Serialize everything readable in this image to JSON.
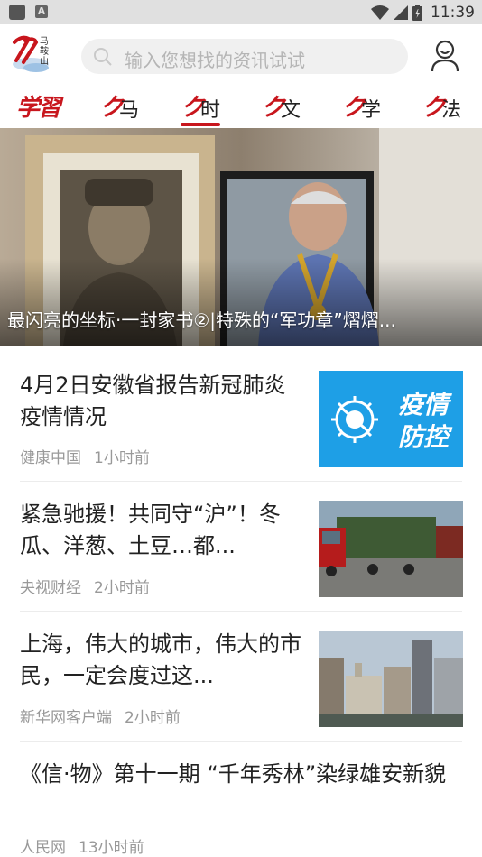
{
  "status_bar": {
    "time": "11:39"
  },
  "header": {
    "logo_text": "马鞍山",
    "search_placeholder": "输入您想找的资讯试试"
  },
  "tabs": {
    "study": "学習",
    "items": [
      {
        "mark": "ク",
        "label": "马"
      },
      {
        "mark": "ク",
        "label": "时"
      },
      {
        "mark": "ク",
        "label": "文"
      },
      {
        "mark": "ク",
        "label": "学"
      },
      {
        "mark": "ク",
        "label": "法"
      }
    ],
    "active_index": 1,
    "accent": "#c8161d"
  },
  "hero": {
    "caption": "最闪亮的坐标·一封家书②|特殊的“军功章”熠熠..."
  },
  "news": [
    {
      "title": "4月2日安徽省报告新冠肺炎疫情情况",
      "source": "健康中国",
      "time": "1小时前",
      "thumb_text_line1": "疫情",
      "thumb_text_line2": "防控"
    },
    {
      "title": "紧急驰援！共同守“沪”！冬瓜、洋葱、土豆…都...",
      "source": "央视财经",
      "time": "2小时前"
    },
    {
      "title": "上海，伟大的城市，伟大的市民，一定会度过这...",
      "source": "新华网客户端",
      "time": "2小时前"
    },
    {
      "title": "《信·物》第十一期 “千年秀林”染绿雄安新貌",
      "source": "人民网",
      "time": "13小时前"
    }
  ]
}
